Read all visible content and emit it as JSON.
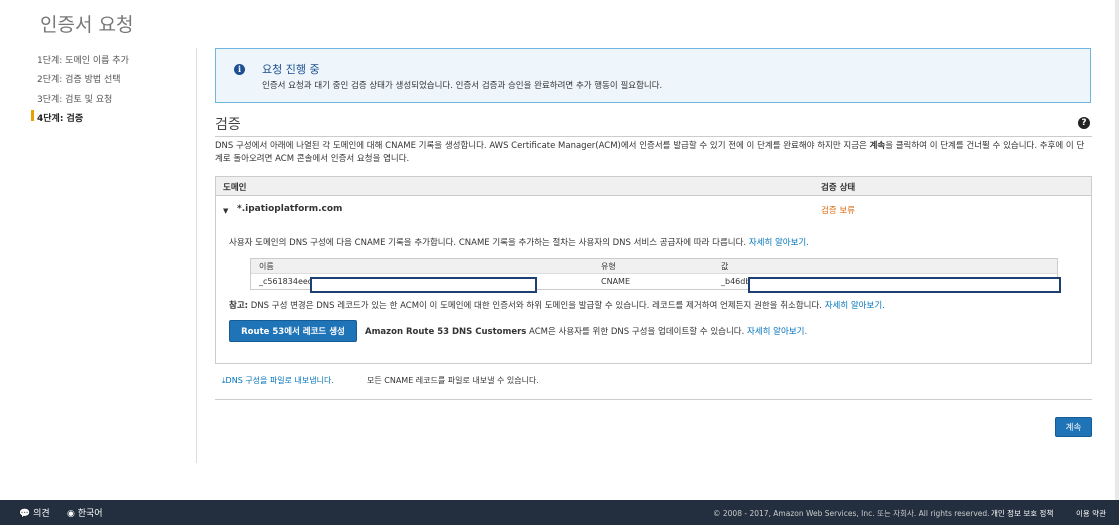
{
  "page_title": "인증서 요청",
  "steps": [
    {
      "label": "1단계: 도메인 이름 추가"
    },
    {
      "label": "2단계: 검증 방법 선택"
    },
    {
      "label": "3단계: 검토 및 요청"
    },
    {
      "label": "4단계: 검증"
    }
  ],
  "info": {
    "icon": "info-icon",
    "title": "요청 진행 중",
    "message": "인증서 요청과 대기 중인 검증 상태가 생성되었습니다. 인증서 검증과 승인을 완료하려면 추가 행동이 필요합니다."
  },
  "validation": {
    "heading": "검증",
    "description_1": "DNS 구성에서 아래에 나열된 각 도메인에 대해 CNAME 기록을 생성합니다. AWS Certificate Manager(ACM)에서 인증서를 발급할 수 있기 전에 이 단계를 완료해야 하지만 지금은 ",
    "description_bold": "계속",
    "description_2": "을 클릭하여 이 단계를 건너뛸 수 있습니다. 추후에 이 단계로 돌아오려면 ACM 콘솔에서 인증서 요청을 엽니다.",
    "table_headers": {
      "domain": "도메인",
      "status": "검증 상태"
    },
    "domain": "*.ipatioplatform.com",
    "status": "검증 보류",
    "status_color": "#dd6b10",
    "inner_desc": "사용자 도메인의 DNS 구성에 다음 CNAME 기록을 추가합니다. CNAME 기록을 추가하는 절차는 사용자의 DNS 서비스 공급자에 따라 다릅니다.",
    "learn_more": "자세히 알아보기.",
    "cname_headers": {
      "name": "이름",
      "type": "유형",
      "value": "값"
    },
    "cname_row": {
      "name": "_c561834eed",
      "type": "CNAME",
      "value": "_b46db"
    },
    "note_label": "참고:",
    "note_text": " DNS 구성 변경은 DNS 레코드가 있는 한 ACM이 이 도메인에 대한 인증서와 하위 도메인을 발급할 수 있습니다. 레코드를 제거하여 언제든지 권한을 취소합니다. ",
    "route53_button": "Route 53에서 레코드 생성",
    "route53_bold": "Amazon Route 53 DNS Customers",
    "route53_text": " ACM은 사용자를 위한 DNS 구성을 업데이트할 수 있습니다. "
  },
  "export": {
    "link": "DNS 구성을 파일로 내보냅니다.",
    "desc": "모든 CNAME 레코드를 파일로 내보낼 수 있습니다."
  },
  "continue_button": "계속",
  "footer": {
    "feedback": "의견",
    "language": "한국어",
    "copyright": "© 2008 - 2017, Amazon Web Services, Inc. 또는 자회사. All rights reserved.",
    "privacy": "개인 정보 보호 정책",
    "terms": "이용 약관"
  },
  "colors": {
    "accent": "#1f73b7",
    "footer": "#232f3e",
    "info_border": "#6eb6dd"
  }
}
